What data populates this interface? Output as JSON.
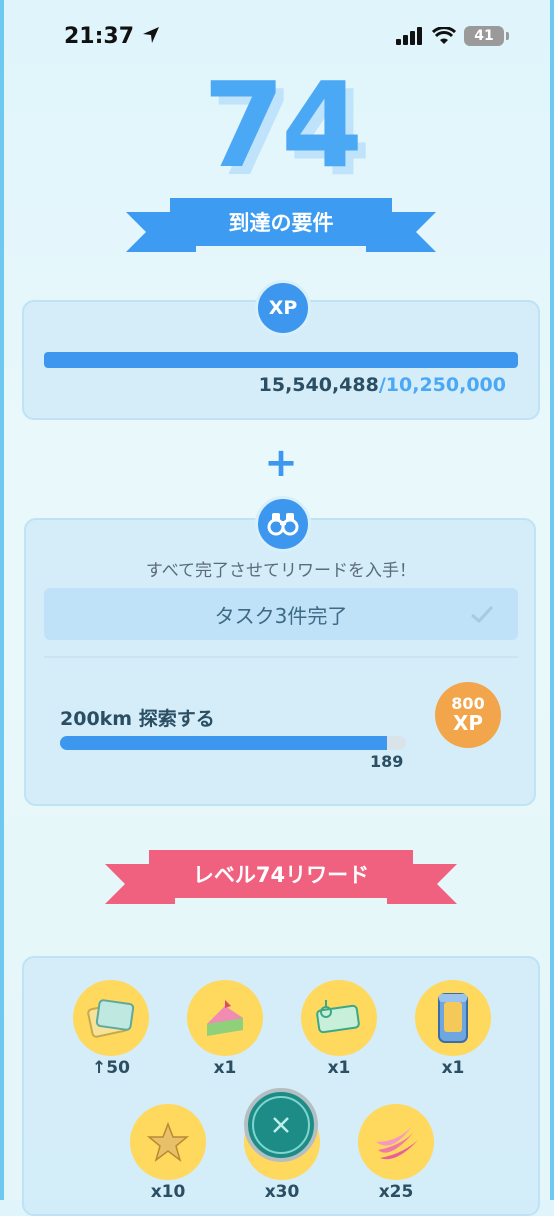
{
  "status_bar": {
    "time": "21:37",
    "battery": "41"
  },
  "level": {
    "number": "74"
  },
  "requirements": {
    "title": "到達の要件",
    "xp_badge": "XP",
    "xp_current": "15,540,488",
    "xp_separator": "/",
    "xp_required": "10,250,000",
    "xp_progress": 1.0
  },
  "plus_sign": "+",
  "tasks": {
    "instructions": "すべて完了させてリワードを入手！",
    "summary": "タスク3件完了",
    "task": {
      "name": "200km 探索する",
      "progress": "189",
      "progress_fraction": 0.945,
      "reward_amount": "800",
      "reward_unit": "XP"
    }
  },
  "rewards": {
    "title": "レベル74リワード",
    "items": [
      {
        "icon": "pass-icon",
        "qty": "50"
      },
      {
        "icon": "cake-slice-icon",
        "qty": "x1"
      },
      {
        "icon": "pass-ticket-icon",
        "qty": "x1"
      },
      {
        "icon": "canister-icon",
        "qty": "x1"
      },
      {
        "icon": "star-piece-icon",
        "qty": "x10"
      },
      {
        "icon": "berry-icon",
        "qty": "x30"
      },
      {
        "icon": "banana-berry-icon",
        "qty": "x25"
      }
    ]
  },
  "colors": {
    "accent_blue": "#3d97ef",
    "ribbon_pink": "#f0607f",
    "reward_orange": "#f2a54a",
    "reward_yellow": "#ffd85e"
  }
}
